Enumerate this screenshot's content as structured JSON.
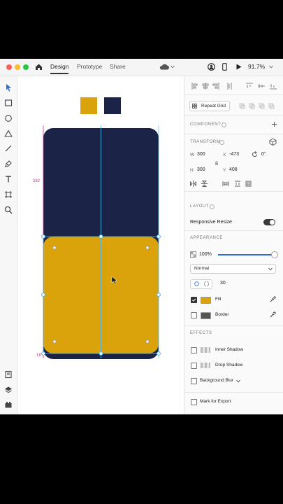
{
  "tabs": {
    "design": "Design",
    "prototype": "Prototype",
    "share": "Share"
  },
  "zoom": "91.7%",
  "canvas": {
    "measure_height": "282",
    "measure_bottom": "18"
  },
  "panel": {
    "repeat_grid": "Repeat Grid",
    "component": "COMPONENT",
    "transform": "TRANSFORM",
    "w_label": "W",
    "w_value": "300",
    "x_label": "X",
    "x_value": "-473",
    "h_label": "H",
    "h_value": "300",
    "y_label": "Y",
    "y_value": "408",
    "rotation": "0°",
    "layout": "LAYOUT",
    "responsive_resize": "Responsive Resize",
    "appearance": "APPEARANCE",
    "opacity": "100%",
    "blend_mode": "Normal",
    "corner_radius": "30",
    "fill_label": "Fill",
    "border_label": "Border",
    "effects": "EFFECTS",
    "inner_shadow": "Inner Shadow",
    "drop_shadow": "Drop Shadow",
    "background_blur": "Background Blur",
    "mark_export": "Mark for Export"
  },
  "colors": {
    "navy": "#1b2447",
    "gold": "#dba30b",
    "accent": "#2d6fd6",
    "guide": "#4fb5e8",
    "measure": "#c2328e"
  }
}
